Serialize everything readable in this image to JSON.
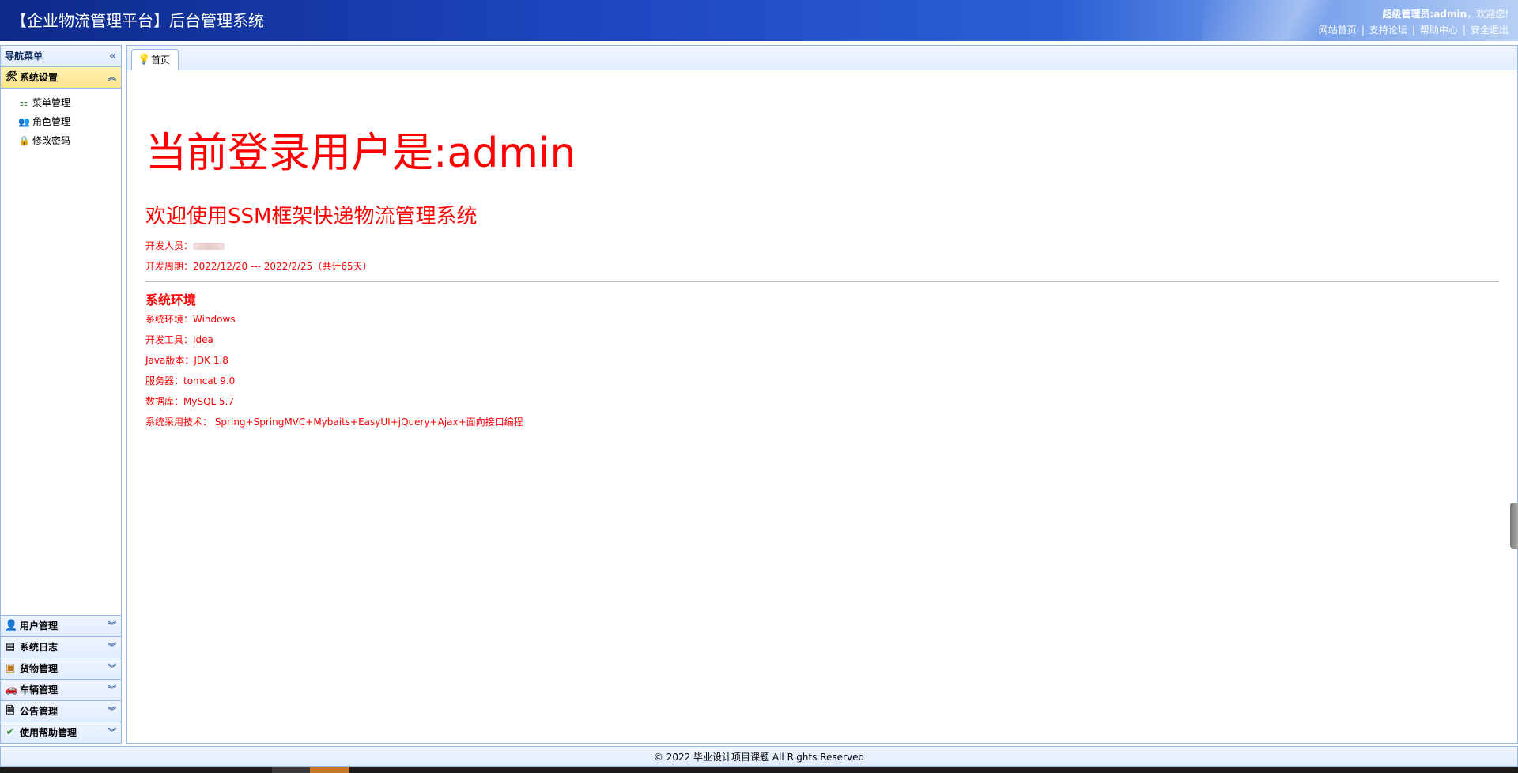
{
  "header": {
    "title": "【企业物流管理平台】后台管理系统",
    "welcome_role": "超级管理员:admin",
    "welcome_suffix": "，欢迎您!",
    "links": [
      "网站首页",
      "支持论坛",
      "帮助中心",
      "安全退出"
    ]
  },
  "sidebar": {
    "title": "导航菜单",
    "active_panel": {
      "label": "系统设置",
      "icon": "tools-icon",
      "items": [
        {
          "label": "菜单管理",
          "icon": "sitemap-icon"
        },
        {
          "label": "角色管理",
          "icon": "users-icon"
        },
        {
          "label": "修改密码",
          "icon": "lock-icon"
        }
      ]
    },
    "panels": [
      {
        "label": "用户管理",
        "icon": "user-group-icon"
      },
      {
        "label": "系统日志",
        "icon": "log-icon"
      },
      {
        "label": "货物管理",
        "icon": "package-icon"
      },
      {
        "label": "车辆管理",
        "icon": "car-icon"
      },
      {
        "label": "公告管理",
        "icon": "document-icon"
      },
      {
        "label": "使用帮助管理",
        "icon": "check-icon"
      }
    ]
  },
  "tabs": [
    {
      "label": "首页",
      "icon": "lightbulb-icon"
    }
  ],
  "content": {
    "login_title": "当前登录用户是:admin",
    "welcome": "欢迎使用SSM框架快递物流管理系统",
    "developer_label": "开发人员：",
    "period": "开发周期：2022/12/20 --- 2022/2/25（共计65天）",
    "env_title": "系统环境",
    "env_lines": [
      "系统环境：Windows",
      "开发工具：Idea",
      "Java版本：JDK 1.8",
      "服务器：tomcat 9.0",
      "数据库：MySQL 5.7",
      "系统采用技术： Spring+SpringMVC+Mybaits+EasyUI+jQuery+Ajax+面向接口编程"
    ]
  },
  "footer": {
    "text": "© 2022 毕业设计项目课题 All Rights Reserved"
  },
  "colors": {
    "accent": "#ff0000",
    "border": "#95b8e7",
    "active_panel": "#ffe48d",
    "header": "#1e47c2"
  }
}
